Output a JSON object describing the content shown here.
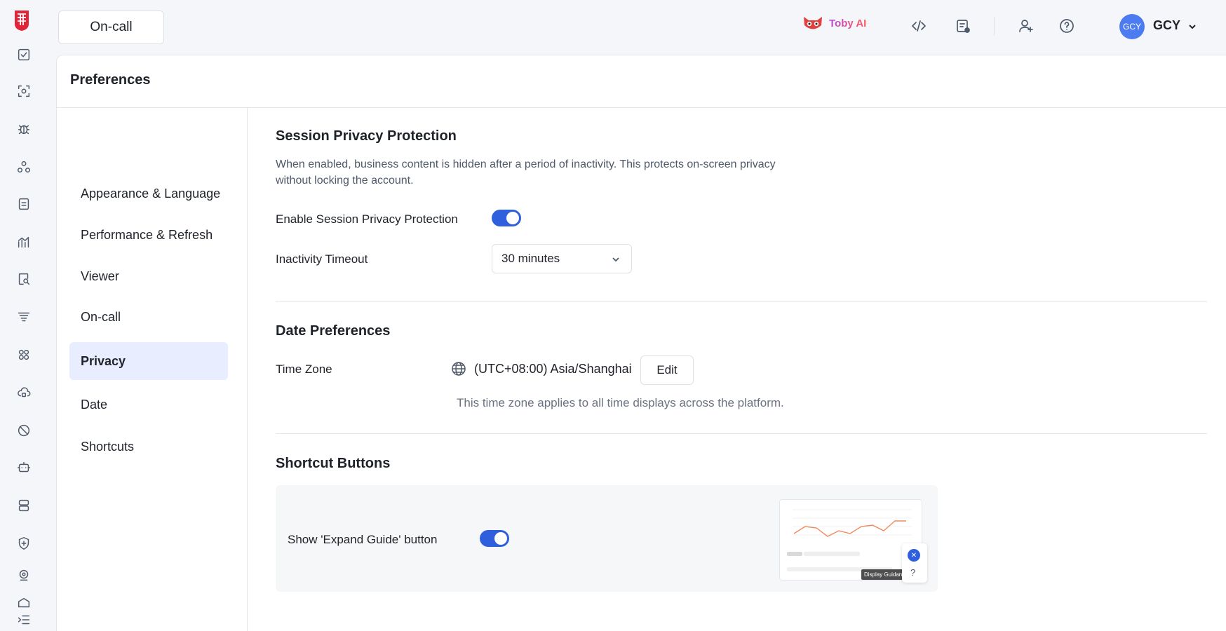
{
  "app": {
    "tab": "On-call",
    "assistant_label": "Toby AI"
  },
  "user": {
    "avatar_text": "GCY",
    "name": "GCY"
  },
  "panel": {
    "title": "Preferences"
  },
  "nav": {
    "items": [
      {
        "label": "Appearance & Language"
      },
      {
        "label": "Performance & Refresh"
      },
      {
        "label": "Viewer"
      },
      {
        "label": "On-call"
      },
      {
        "label": "Privacy"
      },
      {
        "label": "Date"
      },
      {
        "label": "Shortcuts"
      }
    ],
    "active": "Privacy"
  },
  "privacy": {
    "title": "Session Privacy Protection",
    "description": "When enabled, business content is hidden after a period of inactivity. This protects on-screen privacy without locking the account.",
    "enable_label": "Enable Session Privacy Protection",
    "enabled": true,
    "timeout_label": "Inactivity Timeout",
    "timeout_value": "30 minutes"
  },
  "date": {
    "title": "Date Preferences",
    "timezone_label": "Time Zone",
    "timezone_value": "(UTC+08:00) Asia/Shanghai",
    "edit_label": "Edit",
    "timezone_note": "This time zone applies to all time displays across the platform."
  },
  "shortcuts": {
    "title": "Shortcut Buttons",
    "expand_label": "Show 'Expand Guide' button",
    "expand_enabled": true,
    "preview_tooltip": "Display Guidance"
  },
  "colors": {
    "accent": "#2f5fdd",
    "active_nav_bg": "#e8eeff",
    "avatar_bg": "#4d7cf0"
  },
  "icons": {
    "rail": [
      "logo-icon",
      "checkbox-icon",
      "scan-icon",
      "bug-icon",
      "nodes-icon",
      "document-icon",
      "analytics-icon",
      "search-doc-icon",
      "filter-list-icon",
      "apps-icon",
      "cloud-lock-icon",
      "disabled-gauge-icon",
      "robot-icon",
      "server-icon",
      "shield-icon",
      "camera-icon",
      "cube-icon",
      "menu-collapse-icon"
    ],
    "topbar": [
      "toby-mask-icon",
      "code-icon",
      "report-icon",
      "add-user-icon",
      "help-icon",
      "chevron-down-icon"
    ]
  }
}
